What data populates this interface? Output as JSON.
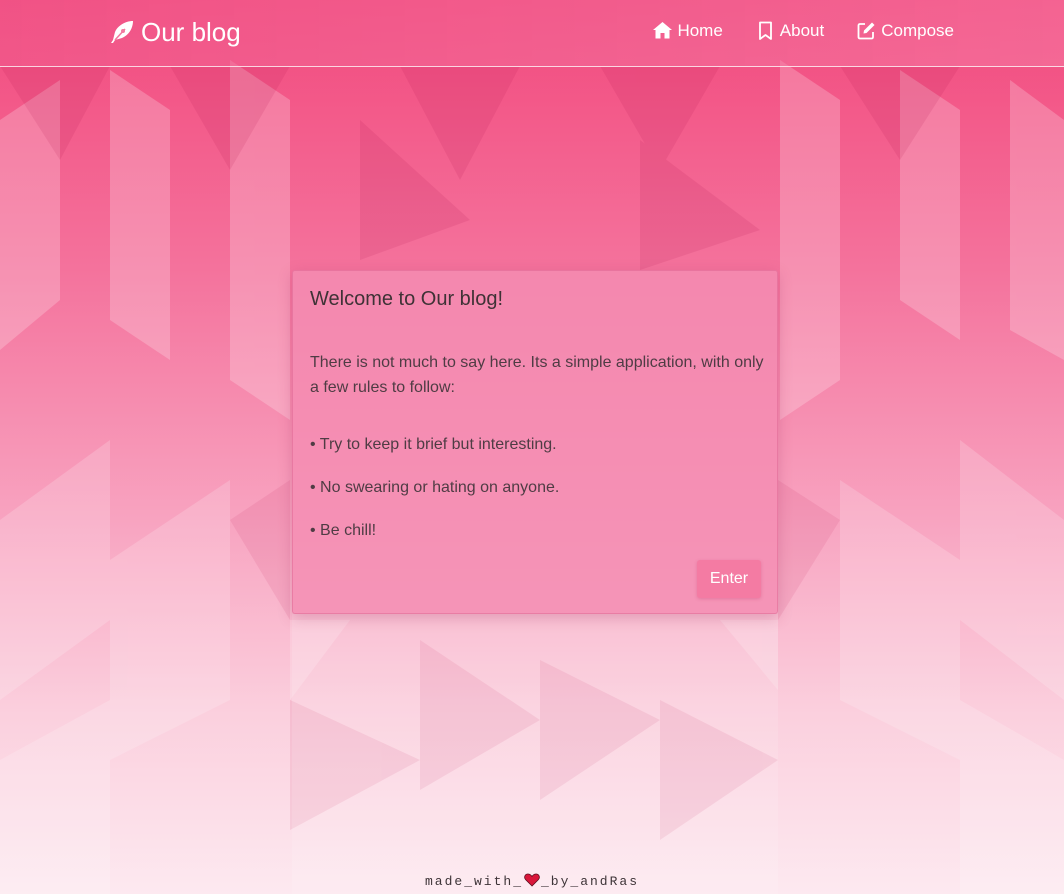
{
  "navbar": {
    "brand": {
      "label": "Our blog",
      "icon": "feather-pen-icon"
    },
    "links": [
      {
        "label": "Home",
        "icon": "home-icon"
      },
      {
        "label": "About",
        "icon": "bookmark-icon"
      },
      {
        "label": "Compose",
        "icon": "compose-icon"
      }
    ]
  },
  "card": {
    "title": "Welcome to Our blog!",
    "intro": "There is not much to say here. Its a simple application, with only a few rules to follow:",
    "rules": [
      "• Try to keep it brief but interesting.",
      "• No swearing or hating on anyone.",
      "• Be chill!"
    ],
    "button_label": "Enter"
  },
  "footer": {
    "before": "made_with_",
    "after": "_by_andRas",
    "icon": "heart-icon"
  },
  "colors": {
    "accent": "#f47ba3",
    "background_top": "#f2497d",
    "background_bottom": "#fde9f0",
    "text": "#4f3c44",
    "heart": "#d9163a"
  }
}
